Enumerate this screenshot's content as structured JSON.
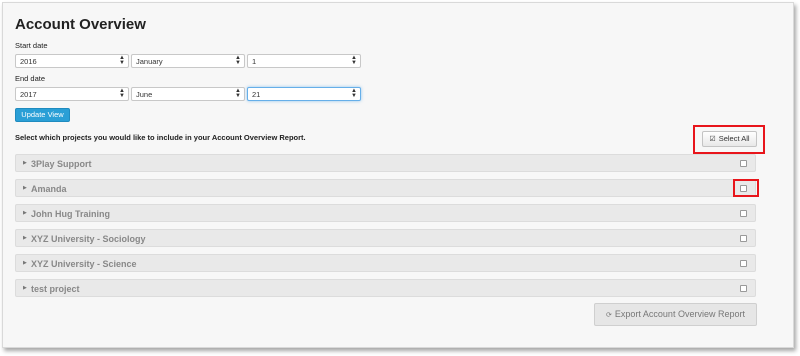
{
  "title": "Account Overview",
  "start": {
    "label": "Start date",
    "year": "2016",
    "month": "January",
    "day": "1"
  },
  "end": {
    "label": "End date",
    "year": "2017",
    "month": "June",
    "day": "21"
  },
  "update_label": "Update View",
  "instruction": "Select which projects you would like to include in your Account Overview Report.",
  "select_all_label": "Select All",
  "projects": [
    {
      "name": "3Play Support",
      "checked": false
    },
    {
      "name": "Amanda",
      "checked": false
    },
    {
      "name": "John Hug Training",
      "checked": false
    },
    {
      "name": "XYZ University - Sociology",
      "checked": false
    },
    {
      "name": "XYZ University - Science",
      "checked": false
    },
    {
      "name": "test project",
      "checked": false
    }
  ],
  "export_label": "Export Account Overview Report",
  "colors": {
    "primary": "#2a9fd6",
    "highlight": "#e8151b",
    "panel": "#f7f7f7"
  },
  "icons": {
    "select_all": "checkbox-checked-icon",
    "export": "refresh-icon",
    "caret": "caret-right-icon",
    "select_arrow": "updown-arrow-icon"
  }
}
